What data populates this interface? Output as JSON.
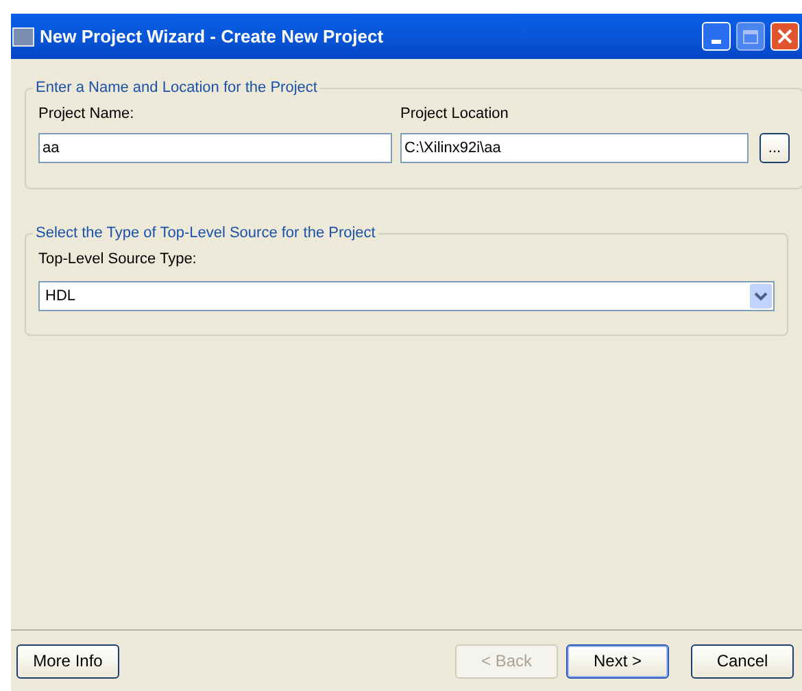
{
  "window": {
    "title": "New Project Wizard - Create New Project"
  },
  "name_location": {
    "legend": "Enter a Name and Location for the Project",
    "name_label": "Project Name:",
    "name_value": "aa",
    "location_label": "Project Location",
    "location_value": "C:\\Xilinx92i\\aa",
    "browse": "..."
  },
  "source": {
    "legend": "Select the Type of Top-Level Source for the Project",
    "label": "Top-Level Source Type:",
    "value": "HDL"
  },
  "buttons": [
    {
      "label": "More Info",
      "disabled": false,
      "default": false
    },
    {
      "label": "< Back",
      "disabled": true,
      "default": false
    },
    {
      "label": "Next >",
      "disabled": false,
      "default": true
    },
    {
      "label": "Cancel",
      "disabled": false,
      "default": false
    }
  ]
}
